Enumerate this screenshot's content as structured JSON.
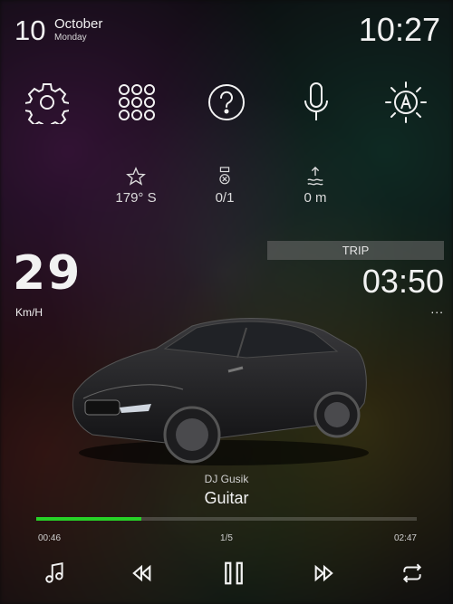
{
  "header": {
    "day": "10",
    "month": "October",
    "weekday": "Monday",
    "time": "10:27"
  },
  "toolbar": {
    "icons": [
      "gear-icon",
      "apps-grid-icon",
      "help-icon",
      "microphone-icon",
      "auto-brightness-icon"
    ]
  },
  "stats": {
    "heading": "179° S",
    "satellites": "0/1",
    "altitude": "0 m"
  },
  "speed": {
    "value": "29",
    "unit": "Km/H"
  },
  "trip": {
    "label": "TRIP",
    "time": "03:50",
    "more": "..."
  },
  "player": {
    "artist": "DJ Gusik",
    "title": "Guitar",
    "elapsed": "00:46",
    "track_index": "1/5",
    "duration": "02:47",
    "progress_fraction": 0.275,
    "accent": "#27d127"
  },
  "colors": {
    "progress": "#27d127",
    "trip_bg": "#6e6e6e"
  }
}
